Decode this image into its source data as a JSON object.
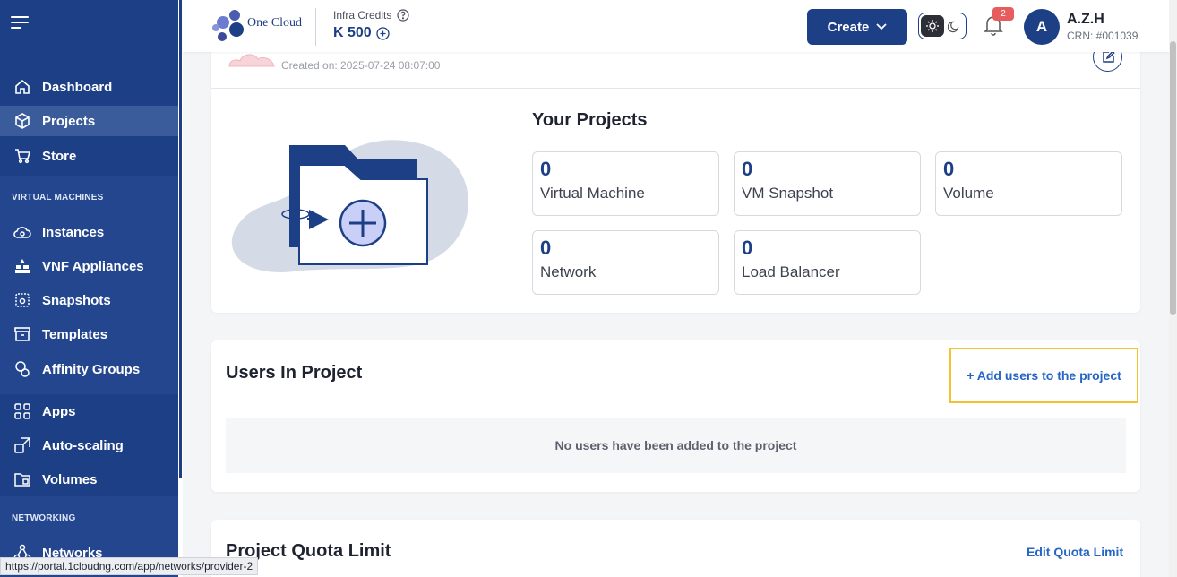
{
  "sidebar": {
    "items_top": [
      {
        "label": "Dashboard",
        "icon": "home-icon",
        "active": false
      },
      {
        "label": "Projects",
        "icon": "cube-icon",
        "active": true
      },
      {
        "label": "Store",
        "icon": "cart-icon",
        "active": false
      }
    ],
    "section_vm": "VIRTUAL MACHINES",
    "items_vm": [
      {
        "label": "Instances",
        "icon": "cloud-icon"
      },
      {
        "label": "VNF Appliances",
        "icon": "appliance-icon"
      },
      {
        "label": "Snapshots",
        "icon": "camera-icon"
      },
      {
        "label": "Templates",
        "icon": "template-icon"
      },
      {
        "label": "Affinity Groups",
        "icon": "affinity-icon"
      }
    ],
    "items_mid": [
      {
        "label": "Apps",
        "icon": "apps-icon"
      },
      {
        "label": "Auto-scaling",
        "icon": "autoscale-icon"
      },
      {
        "label": "Volumes",
        "icon": "volumes-icon"
      }
    ],
    "section_net": "NETWORKING",
    "items_net": [
      {
        "label": "Networks",
        "icon": "network-icon"
      }
    ]
  },
  "header": {
    "logo_text": "One Cloud",
    "credits_label": "Infra Credits",
    "credits_value": "K 500",
    "create_label": "Create",
    "notification_count": "2",
    "avatar_letter": "A",
    "user_name": "A.Z.H",
    "user_crn": "CRN: #001039"
  },
  "project": {
    "created_on": "Created on: 2025-07-24 08:07:00",
    "your_projects_title": "Your Projects",
    "stats": [
      {
        "value": "0",
        "label": "Virtual Machine"
      },
      {
        "value": "0",
        "label": "VM Snapshot"
      },
      {
        "value": "0",
        "label": "Volume"
      },
      {
        "value": "0",
        "label": "Network"
      },
      {
        "value": "0",
        "label": "Load Balancer"
      }
    ]
  },
  "users": {
    "title": "Users In Project",
    "add_label": "+ Add users to the project",
    "empty_text": "No users have been added to the project"
  },
  "quota": {
    "title": "Project Quota Limit",
    "edit_label": "Edit Quota Limit"
  },
  "status_url": "https://portal.1cloudng.com/app/networks/provider-2",
  "colors": {
    "primary": "#1d3f86",
    "link": "#2566c4",
    "highlight": "#f2c230",
    "badge": "#e75d5d"
  }
}
